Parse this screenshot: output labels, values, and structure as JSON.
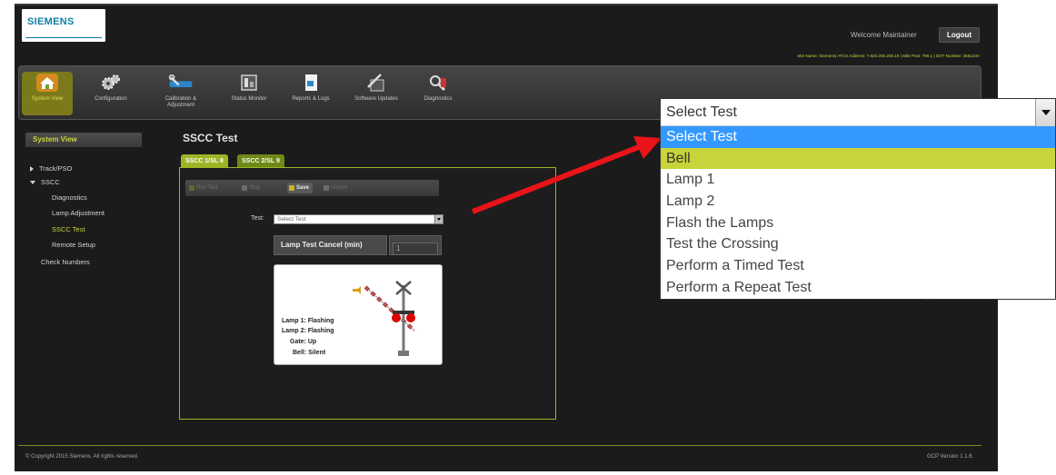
{
  "header": {
    "logo_text": "SIEMENS",
    "welcome": "Welcome Maintainer",
    "logout_label": "Logout",
    "site_info": "Site Name: Siemens| ATCS Address: 7.620.200.200.16 | Mile Post: 789.1 | DOT Number: 456123A"
  },
  "nav": {
    "items": [
      {
        "label": "System View",
        "icon": "house-icon"
      },
      {
        "label": "Configuration",
        "icon": "gear-icon"
      },
      {
        "label": "Calibration & Adjustment",
        "icon": "wrench-icon"
      },
      {
        "label": "Status Monitor",
        "icon": "monitor-icon"
      },
      {
        "label": "Reports & Logs",
        "icon": "report-icon"
      },
      {
        "label": "Software Updates",
        "icon": "update-icon"
      },
      {
        "label": "Diagnostics",
        "icon": "diagnostics-icon"
      }
    ]
  },
  "sidebar": {
    "header": "System View",
    "items": [
      {
        "label": "Track/PSO"
      },
      {
        "label": "SSCC"
      },
      {
        "label": "Diagnostics"
      },
      {
        "label": "Lamp Adjustment"
      },
      {
        "label": "SSCC Test"
      },
      {
        "label": "Remote Setup"
      },
      {
        "label": "Check Numbers"
      }
    ]
  },
  "main": {
    "title": "SSCC Test",
    "tabs": [
      {
        "label": "SSCC 1/SL 8"
      },
      {
        "label": "SSCC 2/SL 9"
      }
    ],
    "toolbar": {
      "run": "Run Test",
      "stop": "Stop",
      "save": "Save",
      "unlock": "Unlock"
    },
    "test_label": "Test:",
    "test_select_value": "Select Test",
    "cancel_label": "Lamp Test Cancel (min)",
    "cancel_value": "1",
    "status": {
      "lamp1": "Lamp 1: Flashing",
      "lamp2": "Lamp 2: Flashing",
      "gate": "Gate: Up",
      "bell": "Bell: Silent"
    }
  },
  "footer": {
    "copyright": "© Copyright 2015 Siemens. All rights reserved.",
    "version": "GCP Version 1.1.6."
  },
  "dropdown": {
    "value": "Select Test",
    "options": [
      "Select Test",
      "Bell",
      "Lamp 1",
      "Lamp 2",
      "Flash the Lamps",
      "Test the Crossing",
      "Perform a Timed Test",
      "Perform a Repeat Test"
    ],
    "selected_index": 0,
    "hover_index": 1
  },
  "annotation_arrow_color": "#e8141a",
  "accent_color": "#9cb525"
}
